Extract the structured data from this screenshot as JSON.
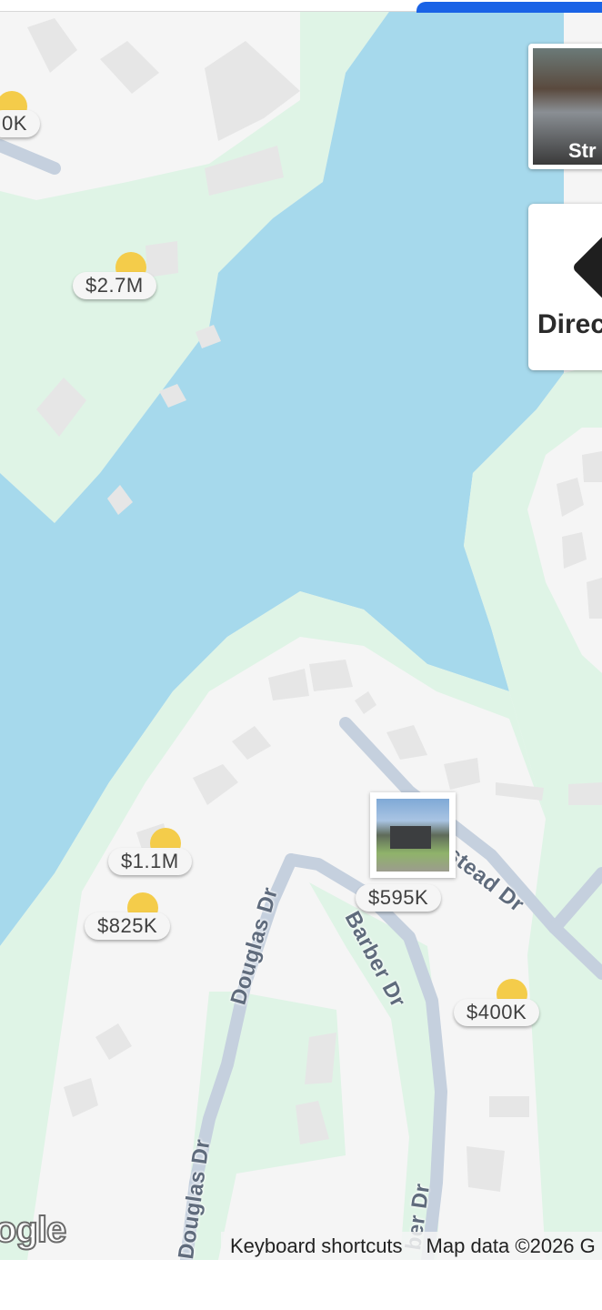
{
  "map": {
    "colors": {
      "water": "#a6d9ec",
      "park": "#dff4e6",
      "land": "#f5f5f5",
      "road": "#c5d0de",
      "building": "#e6e6e6",
      "pin_sun": "#f4cc4a"
    },
    "price_pins": [
      {
        "label": "0K"
      },
      {
        "label": "$2.7M"
      },
      {
        "label": "$1.1M"
      },
      {
        "label": "$825K"
      },
      {
        "label": "$595K"
      },
      {
        "label": "$400K"
      }
    ],
    "road_labels": [
      {
        "label": "Douglas Dr"
      },
      {
        "label": "Douglas Dr"
      },
      {
        "label": "Barber Dr"
      },
      {
        "label": "ber Dr"
      },
      {
        "label": "Homestead Dr"
      }
    ],
    "controls": {
      "street_view_label": "Str",
      "directions_label": "Direc"
    },
    "footer": {
      "logo_text": "ogle",
      "keyboard_shortcuts": "Keyboard shortcuts",
      "map_data": "Map data ©2026 G"
    }
  }
}
